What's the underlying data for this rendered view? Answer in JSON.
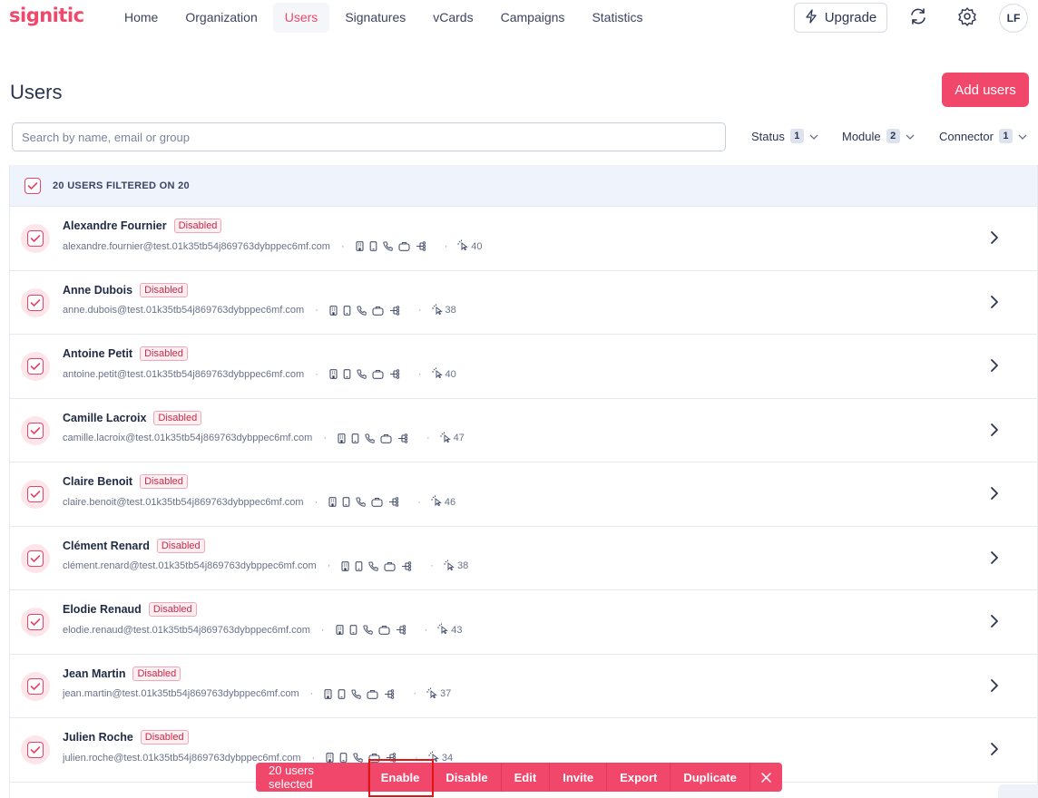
{
  "app": {
    "logo": "signitic"
  },
  "nav": {
    "items": [
      {
        "label": "Home",
        "active": false
      },
      {
        "label": "Organization",
        "active": false
      },
      {
        "label": "Users",
        "active": true
      },
      {
        "label": "Signatures",
        "active": false
      },
      {
        "label": "vCards",
        "active": false
      },
      {
        "label": "Campaigns",
        "active": false
      },
      {
        "label": "Statistics",
        "active": false
      }
    ],
    "upgrade_label": "Upgrade",
    "avatar_initials": "LF"
  },
  "page": {
    "title": "Users",
    "add_button": "Add users"
  },
  "search": {
    "placeholder": "Search by name, email or group",
    "value": ""
  },
  "filters": [
    {
      "label": "Status",
      "count": "1"
    },
    {
      "label": "Module",
      "count": "2"
    },
    {
      "label": "Connector",
      "count": "1"
    }
  ],
  "list_header": {
    "label": "20 USERS FILTERED ON 20",
    "checked": true
  },
  "users": [
    {
      "name": "Alexandre Fournier",
      "badge": "Disabled",
      "email": "alexandre.fournier@test.01k35tb54j869763dybppec6mf.com",
      "clicks": "40"
    },
    {
      "name": "Anne Dubois",
      "badge": "Disabled",
      "email": "anne.dubois@test.01k35tb54j869763dybppec6mf.com",
      "clicks": "38"
    },
    {
      "name": "Antoine Petit",
      "badge": "Disabled",
      "email": "antoine.petit@test.01k35tb54j869763dybppec6mf.com",
      "clicks": "40"
    },
    {
      "name": "Camille Lacroix",
      "badge": "Disabled",
      "email": "camille.lacroix@test.01k35tb54j869763dybppec6mf.com",
      "clicks": "47"
    },
    {
      "name": "Claire Benoit",
      "badge": "Disabled",
      "email": "claire.benoit@test.01k35tb54j869763dybppec6mf.com",
      "clicks": "46"
    },
    {
      "name": "Clément Renard",
      "badge": "Disabled",
      "email": "clément.renard@test.01k35tb54j869763dybppec6mf.com",
      "clicks": "38"
    },
    {
      "name": "Elodie Renaud",
      "badge": "Disabled",
      "email": "elodie.renaud@test.01k35tb54j869763dybppec6mf.com",
      "clicks": "43"
    },
    {
      "name": "Jean Martin",
      "badge": "Disabled",
      "email": "jean.martin@test.01k35tb54j869763dybppec6mf.com",
      "clicks": "37"
    },
    {
      "name": "Julien Roche",
      "badge": "Disabled",
      "email": "julien.roche@test.01k35tb54j869763dybppec6mf.com",
      "clicks": "34"
    }
  ],
  "action_bar": {
    "selected_label": "20 users selected",
    "actions": [
      "Enable",
      "Disable",
      "Edit",
      "Invite",
      "Export",
      "Duplicate"
    ]
  },
  "colors": {
    "brand": "#f0476b",
    "highlight": "#e01616"
  },
  "icons": {
    "upgrade": "lightning-icon",
    "sync": "sync-icon",
    "settings": "gear-icon",
    "row_modules": [
      "building-icon",
      "mobile-icon",
      "phone-icon",
      "briefcase-icon",
      "org-tree-icon"
    ],
    "clicks": "click-pointer-icon",
    "row_open": "chevron-right-icon",
    "close": "close-icon"
  }
}
